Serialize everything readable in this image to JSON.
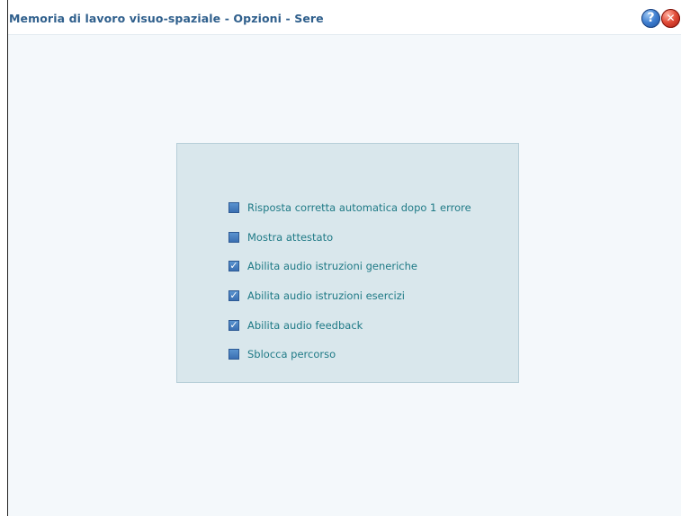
{
  "window": {
    "title": "Memoria di lavoro visuo-spaziale - Opzioni - Sere"
  },
  "titlebar": {
    "help_icon_glyph": "?",
    "close_icon_glyph": "✕"
  },
  "options": [
    {
      "label": "Risposta corretta automatica dopo 1 errore",
      "checked": false
    },
    {
      "label": "Mostra attestato",
      "checked": false
    },
    {
      "label": "Abilita audio istruzioni generiche",
      "checked": true
    },
    {
      "label": "Abilita audio istruzioni esercizi",
      "checked": true
    },
    {
      "label": "Abilita audio feedback",
      "checked": true
    },
    {
      "label": "Sblocca percorso",
      "checked": false
    }
  ],
  "colors": {
    "title": "#2f5f8c",
    "label": "#1f7a86",
    "panel": "#d9e7ec",
    "checkbox": "#3a6fb2"
  }
}
